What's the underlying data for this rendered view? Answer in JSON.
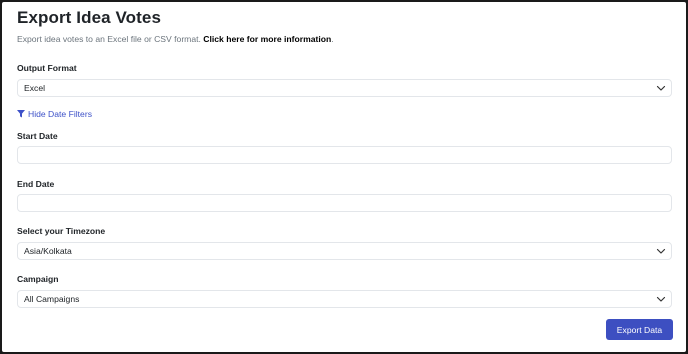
{
  "header": {
    "title": "Export Idea Votes",
    "subtitle": "Export idea votes to an Excel file or CSV format.",
    "more_info_link": "Click here for more information",
    "period": "."
  },
  "output_format": {
    "label": "Output Format",
    "value": "Excel"
  },
  "date_filters": {
    "toggle_label": "Hide Date Filters"
  },
  "start_date": {
    "label": "Start Date",
    "value": ""
  },
  "end_date": {
    "label": "End Date",
    "value": ""
  },
  "timezone": {
    "label": "Select your Timezone",
    "value": "Asia/Kolkata"
  },
  "campaign": {
    "label": "Campaign",
    "value": "All Campaigns"
  },
  "actions": {
    "export_label": "Export Data"
  },
  "colors": {
    "accent": "#3d4fc1",
    "link": "#3d51c8"
  },
  "icons": {
    "filter": "filter-icon",
    "dropdown": "chevron-down-icon"
  }
}
